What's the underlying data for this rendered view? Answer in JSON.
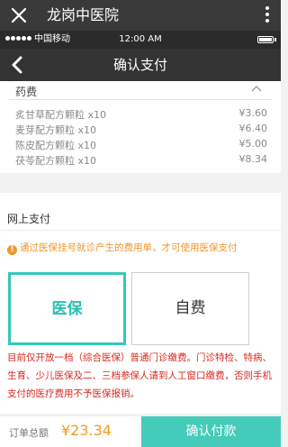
{
  "app_bar": {
    "title": "龙岗中医院"
  },
  "status_bar": {
    "carrier": "中国移动",
    "time": "12:00 AM"
  },
  "nav_bar": {
    "title": "确认支付"
  },
  "drugs": {
    "header": "药费",
    "items": [
      {
        "name": "炙甘草配方颗粒 x10",
        "price": "¥3.60"
      },
      {
        "name": "麦芽配方颗粒 x10",
        "price": "¥6.40"
      },
      {
        "name": "陈皮配方颗粒 x10",
        "price": "¥5.00"
      },
      {
        "name": "茯苓配方颗粒 x10",
        "price": "¥8.34"
      }
    ]
  },
  "payment": {
    "title": "网上支付",
    "notice": "通过医保挂号就诊产生的费用单，才可使用医保支付",
    "option_insurance": "医保",
    "option_self": "自费",
    "selected": "医保",
    "policy": "目前仅开放一档（综合医保）普通门诊缴费。门诊特检、特病、生育、少儿医保及二、三档参保人请到人工窗口缴费，否则手机支付的医疗费用不予医保报销。"
  },
  "footer": {
    "total_label": "订单总额",
    "total_amount": "¥23.34",
    "confirm_label": "确认付款"
  },
  "colors": {
    "accent": "#45cbb9",
    "warning": "#f0962d",
    "alert": "#d9291f",
    "price": "#f39c1a"
  }
}
